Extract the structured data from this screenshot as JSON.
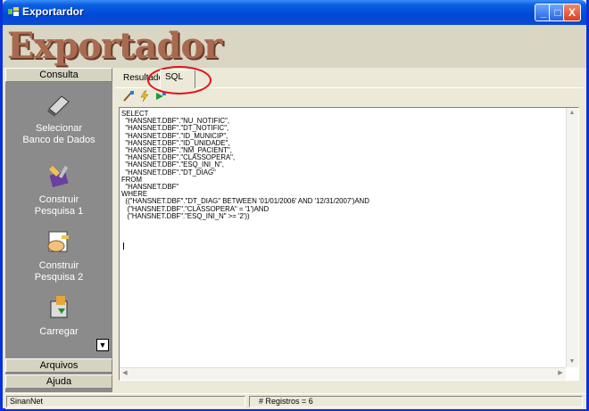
{
  "window": {
    "title": "Exportardor",
    "minimize_glyph": "_",
    "maximize_glyph": "□",
    "close_glyph": "X"
  },
  "banner": {
    "logo_text": "Exportador"
  },
  "sidebar": {
    "headers": {
      "consulta": "Consulta",
      "arquivos": "Arquivos",
      "ajuda": "Ajuda"
    },
    "items": [
      {
        "label": "Selecionar\nBanco de Dados",
        "icon": "eraser-icon"
      },
      {
        "label": "Construir\nPesquisa 1",
        "icon": "tools-icon"
      },
      {
        "label": "Construir\nPesquisa 2",
        "icon": "hand-icon"
      },
      {
        "label": "Carregar",
        "icon": "disk-icon"
      }
    ],
    "scroll_glyph": "▼"
  },
  "tabs": [
    {
      "label": "Resultado",
      "active": false
    },
    {
      "label": "SQL",
      "active": true
    }
  ],
  "toolbar": {
    "icons": [
      "brush-icon",
      "lightning-icon",
      "play-icon"
    ]
  },
  "editor": {
    "sql": "SELECT\n  \"HANSNET.DBF\".\"NU_NOTIFIC\",\n  \"HANSNET.DBF\".\"DT_NOTIFIC\",\n  \"HANSNET.DBF\".\"ID_MUNICIP\",\n  \"HANSNET.DBF\".\"ID_UNIDADE\",\n  \"HANSNET.DBF\".\"NM_PACIENT\",\n  \"HANSNET.DBF\".\"CLASSOPERA\",\n  \"HANSNET.DBF\".\"ESQ_INI_N\",\n  \"HANSNET.DBF\".\"DT_DIAG\"\nFROM\n  \"HANSNET.DBF\"\nWHERE\n  ((\"HANSNET.DBF\".\"DT_DIAG\" BETWEEN '01/01/2006' AND '12/31/2007')AND\n   (\"HANSNET.DBF\".\"CLASSOPERA\" = '1')AND\n   (\"HANSNET.DBF\".\"ESQ_INI_N\" >= '2'))"
  },
  "status": {
    "left": "SinanNet",
    "registros": "# Registros = 6"
  },
  "colors": {
    "title_bar": "#0048d8",
    "sidebar": "#8b8b8b",
    "logo": "#a86a50",
    "annotation": "#e0121a"
  }
}
